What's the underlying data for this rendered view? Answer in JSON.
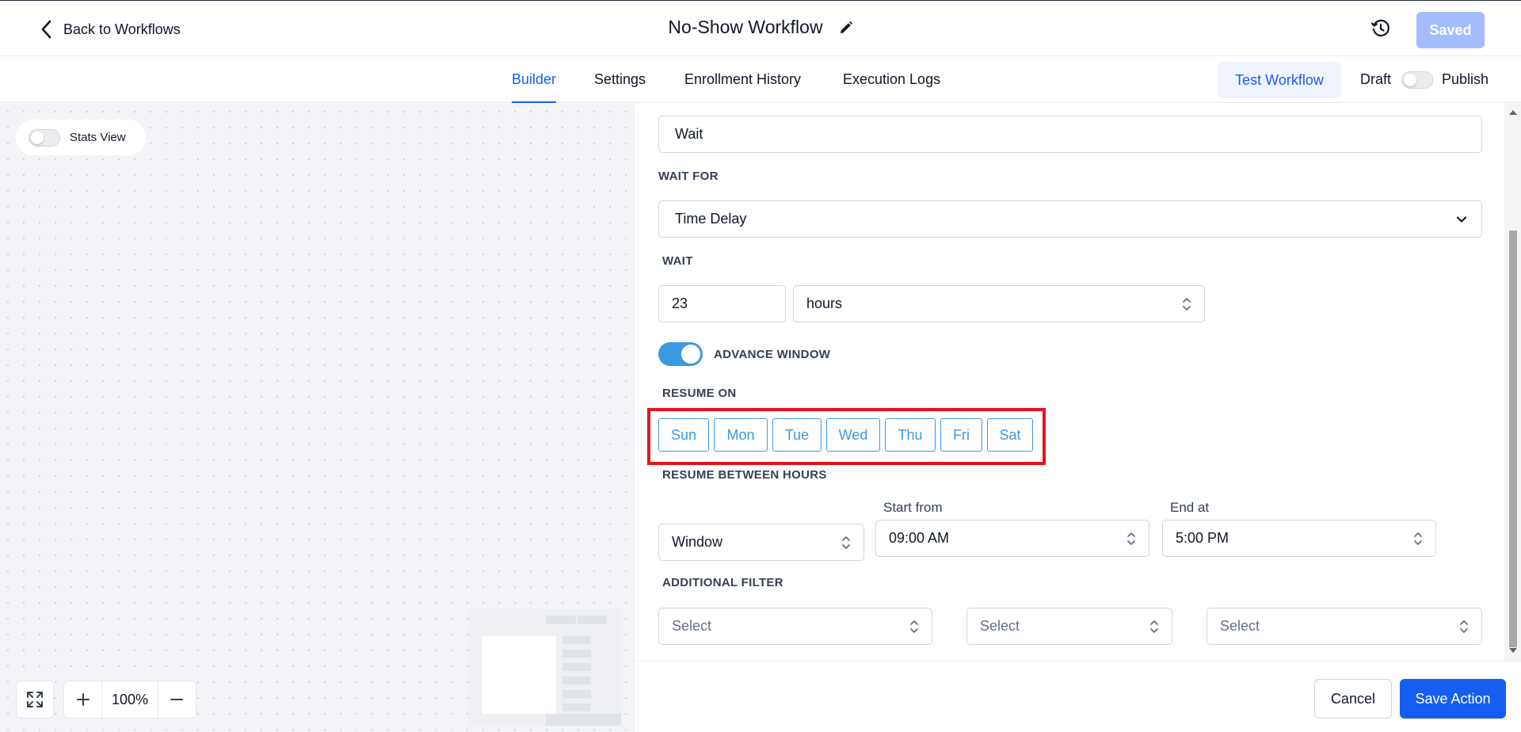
{
  "header": {
    "back_label": "Back to Workflows",
    "workflow_title": "No-Show Workflow",
    "saved_label": "Saved"
  },
  "tabs": [
    {
      "label": "Builder",
      "active": true
    },
    {
      "label": "Settings",
      "active": false
    },
    {
      "label": "Enrollment History",
      "active": false
    },
    {
      "label": "Execution Logs",
      "active": false
    }
  ],
  "actions": {
    "test_workflow_label": "Test Workflow",
    "draft_label": "Draft",
    "publish_label": "Publish",
    "publish_toggle_on": false
  },
  "canvas": {
    "stats_view_label": "Stats View",
    "stats_view_on": false,
    "zoom_level": "100%"
  },
  "panel": {
    "action_name_value": "Wait",
    "wait_for": {
      "label": "WAIT FOR",
      "value": "Time Delay"
    },
    "wait": {
      "label": "WAIT",
      "amount": "23",
      "unit": "hours"
    },
    "advance_window": {
      "label": "ADVANCE WINDOW",
      "on": true
    },
    "resume_on": {
      "label": "RESUME ON",
      "days": [
        "Sun",
        "Mon",
        "Tue",
        "Wed",
        "Thu",
        "Fri",
        "Sat"
      ]
    },
    "resume_between_hours": {
      "label": "RESUME BETWEEN HOURS",
      "mode": "Window",
      "start_label": "Start from",
      "start_value": "09:00 AM",
      "end_label": "End at",
      "end_value": "5:00 PM"
    },
    "additional_filter": {
      "label": "ADDITIONAL FILTER",
      "selects": [
        "Select",
        "Select",
        "Select"
      ]
    }
  },
  "footer": {
    "cancel_label": "Cancel",
    "save_label": "Save Action"
  },
  "colors": {
    "primary": "#155eef",
    "accent_blue": "#3b9ae1",
    "highlight_red": "#e5141f",
    "saved_disabled": "#a4bcfd"
  }
}
